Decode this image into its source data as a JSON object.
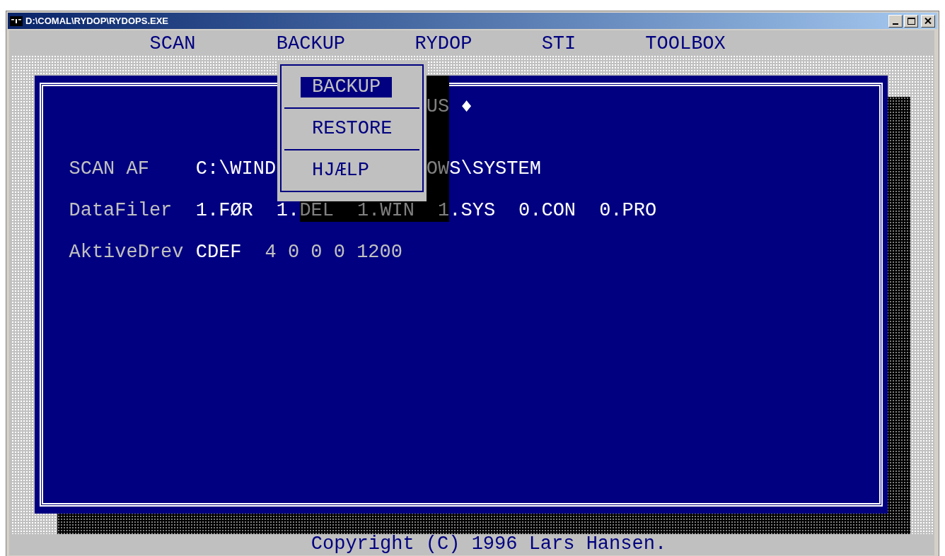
{
  "window": {
    "title": "D:\\COMAL\\RYDOP\\RYDOPS.EXE"
  },
  "menu_bar": [
    "SCAN",
    "BACKUP",
    "RYDOP",
    "STI",
    "TOOLBOX"
  ],
  "dropdown": {
    "items": [
      {
        "label": "BACKUP",
        "selected": true
      },
      {
        "label": "RESTORE",
        "selected": false
      },
      {
        "label": "HJÆLP",
        "selected": false
      }
    ]
  },
  "panel": {
    "lines": [
      {
        "segments": [
          {
            "kind": "shadowed",
            "text": "US"
          },
          {
            "kind": "value",
            "text": "♦"
          }
        ]
      },
      {
        "segments": [
          {
            "kind": "label",
            "text": "SCAN AF"
          },
          {
            "kind": "value",
            "text": "C:\\WIND"
          },
          {
            "kind": "shadowed",
            "text": "OW"
          },
          {
            "kind": "value",
            "text": "S\\SYSTEM"
          }
        ]
      },
      {
        "segments": [
          {
            "kind": "label",
            "text": "DataFiler"
          },
          {
            "kind": "value",
            "text": "1.FØR"
          },
          {
            "kind": "value",
            "text": "1."
          },
          {
            "kind": "shadowed",
            "text": "DEL"
          },
          {
            "kind": "shadowed",
            "text": "1.WIN"
          },
          {
            "kind": "shadowed",
            "text": "1"
          },
          {
            "kind": "value",
            "text": ".SYS"
          },
          {
            "kind": "value",
            "text": "0.CON"
          },
          {
            "kind": "value",
            "text": "0.PRO"
          }
        ]
      },
      {
        "segments": [
          {
            "kind": "label",
            "text": "AktiveDrev"
          },
          {
            "kind": "value",
            "text": "CDEF"
          },
          {
            "kind": "label",
            "text": "4 0 0 0 1200"
          }
        ]
      }
    ]
  },
  "status_bar": "Copyright (C) 1996 Lars Hansen."
}
